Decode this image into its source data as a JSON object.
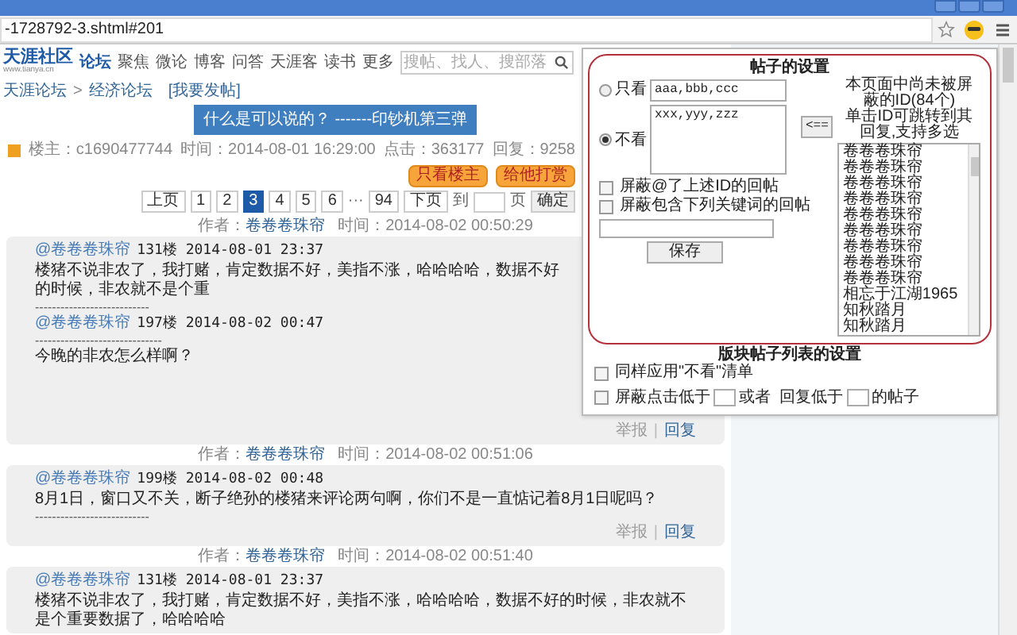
{
  "browser": {
    "url": "-1728792-3.shtml#201"
  },
  "site_nav": {
    "logo": "天涯社区",
    "logo_sub": "www.tianya.cn",
    "items": [
      {
        "label": "论坛",
        "selected": true
      },
      {
        "label": "聚焦",
        "selected": false
      },
      {
        "label": "微论",
        "selected": false
      },
      {
        "label": "博客",
        "selected": false
      },
      {
        "label": "问答",
        "selected": false
      },
      {
        "label": "天涯客",
        "selected": false
      },
      {
        "label": "读书",
        "selected": false
      },
      {
        "label": "更多",
        "selected": false
      }
    ],
    "search": {
      "placeholder": "搜帖、找人、搜部落"
    }
  },
  "breadcrumb": {
    "items": [
      "天涯论坛",
      "经济论坛"
    ],
    "separator": ">",
    "post_link": "[我要发帖]"
  },
  "thread": {
    "title": "什么是可以说的？ -------印钞机第三弹",
    "meta": [
      {
        "label": "楼主：",
        "value": "c1690477744"
      },
      {
        "label": "时间：",
        "value": "2014-08-01 16:29:00"
      },
      {
        "label": "点击：",
        "value": "363177"
      },
      {
        "label": "回复：",
        "value": "9258"
      }
    ],
    "buttons": [
      "只看楼主",
      "给他打赏"
    ]
  },
  "pagination": {
    "prev": "上页",
    "next": "下页",
    "pages": [
      {
        "kind": "page",
        "label": "1",
        "selected": false
      },
      {
        "kind": "page",
        "label": "2",
        "selected": false
      },
      {
        "kind": "page",
        "label": "3",
        "selected": true
      },
      {
        "kind": "page",
        "label": "4",
        "selected": false
      },
      {
        "kind": "page",
        "label": "5",
        "selected": false
      },
      {
        "kind": "page",
        "label": "6",
        "selected": false
      },
      {
        "kind": "gap",
        "label": "···"
      },
      {
        "kind": "page",
        "label": "94",
        "selected": false
      }
    ],
    "jump_before": "到",
    "jump_after": "页",
    "confirm": "确定"
  },
  "posts": [
    {
      "author_label": "作者：",
      "author": "卷卷卷珠帘",
      "time_label": "时间：",
      "time": "2014-08-02 00:50:29",
      "lines": [
        {
          "kind": "mention",
          "user": "@卷卷卷珠帘",
          "info": "131楼 2014-08-01 23:37"
        },
        {
          "kind": "text",
          "text": "楼猪不说非农了，我打赌，肯定数据不好，美指不涨，哈哈哈哈，数据不好的时候，非农就不是个重"
        },
        {
          "kind": "rule",
          "text": "---------------------------"
        },
        {
          "kind": "mention",
          "user": "@卷卷卷珠帘",
          "info": "197楼 2014-08-02 00:47"
        },
        {
          "kind": "rule",
          "text": "------------------------------"
        },
        {
          "kind": "text",
          "text": "今晚的非农怎么样啊？"
        }
      ],
      "actions": [
        "举报",
        "回复"
      ],
      "action_separator": "|"
    },
    {
      "author_label": "作者：",
      "author": "卷卷卷珠帘",
      "time_label": "时间：",
      "time": "2014-08-02 00:51:06",
      "lines": [
        {
          "kind": "mention",
          "user": "@卷卷卷珠帘",
          "info": "199楼 2014-08-02 00:48"
        },
        {
          "kind": "text",
          "text": "8月1日，窗口又不关，断子绝孙的楼猪来评论两句啊，你们不是一直惦记着8月1日呢吗？"
        },
        {
          "kind": "rule",
          "text": "---------------------------"
        }
      ],
      "actions": [
        "举报",
        "回复"
      ],
      "action_separator": "|"
    },
    {
      "author_label": "作者：",
      "author": "卷卷卷珠帘",
      "time_label": "时间：",
      "time": "2014-08-02 00:51:40",
      "lines": [
        {
          "kind": "mention",
          "user": "@卷卷卷珠帘",
          "info": "131楼 2014-08-01 23:37"
        },
        {
          "kind": "text",
          "text": "楼猪不说非农了，我打赌，肯定数据不好，美指不涨，哈哈哈哈，数据不好的时候，非农就不是个重要数据了，哈哈哈哈"
        }
      ]
    }
  ],
  "popup": {
    "title": "帖子的设置",
    "modes": [
      {
        "label": "只看",
        "selected": false,
        "value": "aaa,bbb,ccc"
      },
      {
        "label": "不看",
        "selected": true,
        "value": "xxx,yyy,zzz"
      }
    ],
    "options": [
      {
        "label": "屏蔽@了上述ID的回帖",
        "checked": false
      },
      {
        "label": "屏蔽包含下列关键词的回帖",
        "checked": false
      }
    ],
    "save": "保存",
    "move_button": "<==",
    "id_header": [
      "本页面中尚未被屏蔽的ID(84个)",
      "单击ID可跳转到其回复,支持多选"
    ],
    "ids": [
      "卷卷卷珠帘",
      "卷卷卷珠帘",
      "卷卷卷珠帘",
      "卷卷卷珠帘",
      "卷卷卷珠帘",
      "卷卷卷珠帘",
      "卷卷卷珠帘",
      "卷卷卷珠帘",
      "卷卷卷珠帘",
      "相忘于江湖1965",
      "知秋踏月",
      "知秋踏月"
    ],
    "list_title": "版块帖子列表的设置",
    "apply_option": {
      "label": "同样应用\"不看\"清单",
      "checked": false
    },
    "filter": {
      "label": "屏蔽点击低于",
      "checked": false,
      "middle": "或者  回复低于",
      "end": "的帖子"
    }
  }
}
